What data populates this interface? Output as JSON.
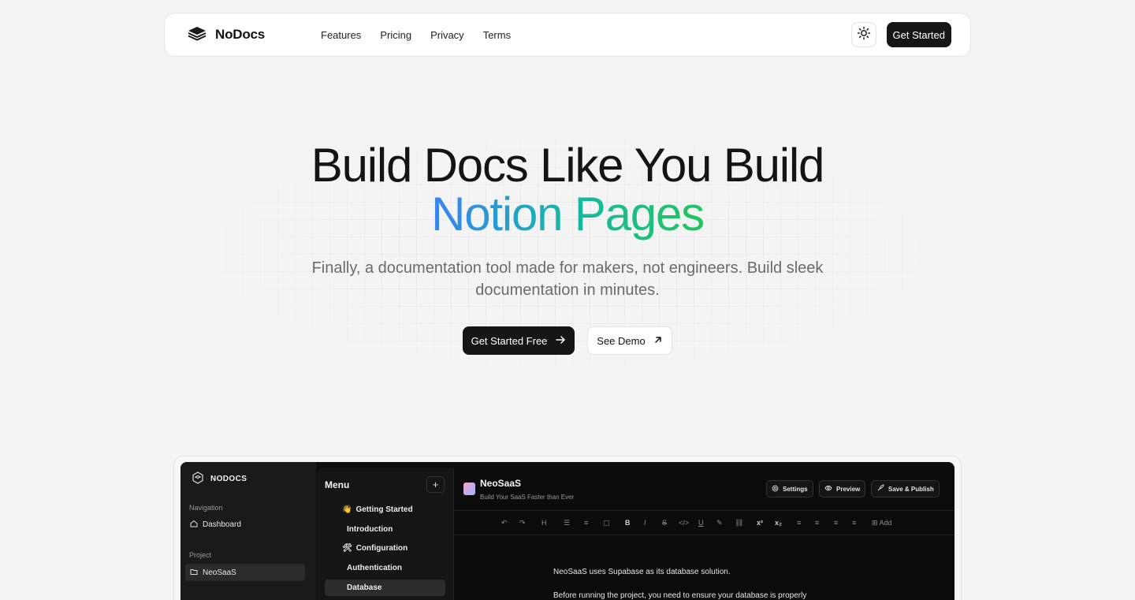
{
  "nav": {
    "brand": "NoDocs",
    "links": [
      "Features",
      "Pricing",
      "Privacy",
      "Terms"
    ],
    "cta": "Get Started"
  },
  "hero": {
    "title_line1": "Build Docs Like You Build",
    "title_line2": "Notion Pages",
    "subtitle": "Finally, a documentation tool made for makers, not engineers. Build sleek documentation in minutes.",
    "primary_cta": "Get Started Free",
    "secondary_cta": "See Demo",
    "accent_gradient": [
      "#3b82f6",
      "#14b8a6",
      "#22c55e"
    ]
  },
  "app_preview": {
    "brand": "NODOCS",
    "nav_label": "Navigation",
    "dashboard": "Dashboard",
    "project_label": "Project",
    "project": "NeoSaaS",
    "menu_title": "Menu",
    "menu_add": "+",
    "menu_items": [
      {
        "emoji": "👋",
        "label": "Getting Started"
      },
      {
        "emoji": "",
        "label": "Introduction"
      },
      {
        "emoji": "🛠",
        "label": "Configuration"
      },
      {
        "emoji": "",
        "label": "Authentication"
      },
      {
        "emoji": "",
        "label": "Database"
      }
    ],
    "doc_title": "NeoSaaS",
    "doc_subtitle": "Build Your SaaS Faster than Ever",
    "buttons": {
      "settings": "Settings",
      "preview": "Preview",
      "publish": "Save & Publish"
    },
    "toolbar": {
      "heading": "H",
      "bold": "B",
      "italic": "I",
      "strike": "S",
      "code": "</>",
      "underline": "U",
      "sup": "x²",
      "sub": "x₂",
      "add": "Add"
    },
    "content": [
      "NeoSaaS uses Supabase as its database solution.",
      "Before running the project, you need to ensure your database is properly"
    ]
  }
}
